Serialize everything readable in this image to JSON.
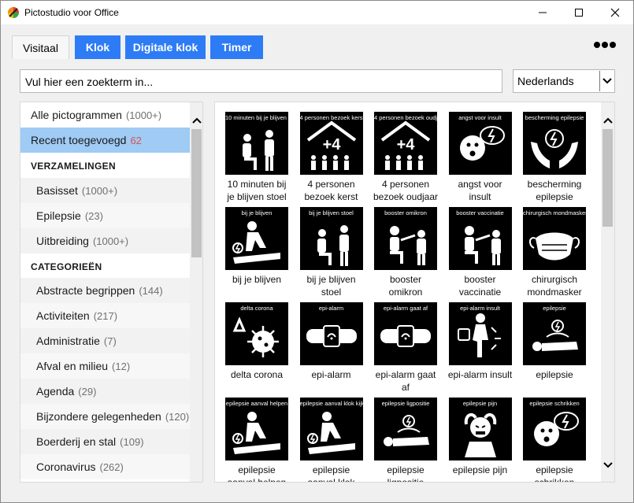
{
  "window": {
    "title": "Pictostudio voor Office",
    "logo_icon": "app-logo-icon",
    "controls": [
      "minimize-icon",
      "maximize-icon",
      "close-icon"
    ]
  },
  "tabs": [
    {
      "label": "Visitaal",
      "active": true
    },
    {
      "label": "Klok",
      "active": false
    },
    {
      "label": "Digitale klok",
      "active": false
    },
    {
      "label": "Timer",
      "active": false
    }
  ],
  "more_menu_icon": "ellipsis-icon",
  "search": {
    "value": "Vul hier een zoekterm in..."
  },
  "language": {
    "selected": "Nederlands"
  },
  "colors": {
    "tab_blue": "#2d7cf6",
    "selected_row": "#9fcbf5",
    "count_red": "#d9534f"
  },
  "sidebar": {
    "all": {
      "label": "Alle pictogrammen",
      "count": "(1000+)"
    },
    "recent": {
      "label": "Recent toegevoegd",
      "count": "62"
    },
    "collections_heading": "VERZAMELINGEN",
    "collections": [
      {
        "label": "Basisset",
        "count": "(1000+)"
      },
      {
        "label": "Epilepsie",
        "count": "(23)"
      },
      {
        "label": "Uitbreiding",
        "count": "(1000+)"
      }
    ],
    "categories_heading": "CATEGORIEËN",
    "categories": [
      {
        "label": "Abstracte begrippen",
        "count": "(144)"
      },
      {
        "label": "Activiteiten",
        "count": "(217)"
      },
      {
        "label": "Administratie",
        "count": "(7)"
      },
      {
        "label": "Afval en milieu",
        "count": "(12)"
      },
      {
        "label": "Agenda",
        "count": "(29)"
      },
      {
        "label": "Bijzondere gelegenheden",
        "count": "(120)"
      },
      {
        "label": "Boerderij en stal",
        "count": "(109)"
      },
      {
        "label": "Coronavirus",
        "count": "(262)"
      }
    ]
  },
  "pictograms": [
    {
      "caption": "10 minuten bij je blijven stoel",
      "label_1": "10 minuten bij",
      "label_2": "je blijven stoel",
      "icon": "sitting-people-icon"
    },
    {
      "caption": "4 personen bezoek kerst",
      "label_1": "4 personen",
      "label_2": "bezoek kerst",
      "icon": "house-plus-four-icon"
    },
    {
      "caption": "4 personen bezoek oudjaar",
      "label_1": "4 personen",
      "label_2": "bezoek oudjaar",
      "icon": "house-plus-four-icon"
    },
    {
      "caption": "angst voor insult",
      "label_1": "angst voor",
      "label_2": "insult",
      "icon": "fearful-face-icon"
    },
    {
      "caption": "bescherming epilepsie",
      "label_1": "bescherming",
      "label_2": "epilepsie",
      "icon": "protecting-hands-icon"
    },
    {
      "caption": "bij je blijven",
      "label_1": "bij je blijven",
      "label_2": "",
      "icon": "kneeling-helper-icon"
    },
    {
      "caption": "bij je blijven stoel",
      "label_1": "bij je blijven",
      "label_2": "stoel",
      "icon": "sitting-people-icon"
    },
    {
      "caption": "booster omikron",
      "label_1": "booster",
      "label_2": "omikron",
      "icon": "vaccination-icon"
    },
    {
      "caption": "booster vaccinatie",
      "label_1": "booster",
      "label_2": "vaccinatie",
      "icon": "vaccination-icon"
    },
    {
      "caption": "chirurgisch mondmasker",
      "label_1": "chirurgisch",
      "label_2": "mondmasker",
      "icon": "face-mask-icon"
    },
    {
      "caption": "delta corona",
      "label_1": "delta corona",
      "label_2": "",
      "icon": "virus-icon"
    },
    {
      "caption": "epi-alarm",
      "label_1": "epi-alarm",
      "label_2": "",
      "icon": "wrist-alarm-icon"
    },
    {
      "caption": "epi-alarm gaat af",
      "label_1": "epi-alarm gaat",
      "label_2": "af",
      "icon": "wrist-alarm-icon"
    },
    {
      "caption": "epi-alarm insult",
      "label_1": "epi-alarm insult",
      "label_2": "",
      "icon": "falling-person-icon"
    },
    {
      "caption": "epilepsie",
      "label_1": "epilepsie",
      "label_2": "",
      "icon": "lying-person-icon"
    },
    {
      "caption": "epilepsie aanval helpen",
      "label_1": "epilepsie",
      "label_2": "aanval helpen",
      "icon": "kneeling-helper-icon"
    },
    {
      "caption": "epilepsie aanval klok kijken",
      "label_1": "epilepsie",
      "label_2": "aanval klok",
      "icon": "kneeling-helper-icon"
    },
    {
      "caption": "epilepsie ligpositie",
      "label_1": "epilepsie",
      "label_2": "ligpositie",
      "icon": "lying-person-icon"
    },
    {
      "caption": "epilepsie pijn",
      "label_1": "epilepsie pijn",
      "label_2": "",
      "icon": "pain-head-icon"
    },
    {
      "caption": "epilepsie schrikken",
      "label_1": "epilepsie",
      "label_2": "schrikken",
      "icon": "fearful-face-icon"
    }
  ]
}
